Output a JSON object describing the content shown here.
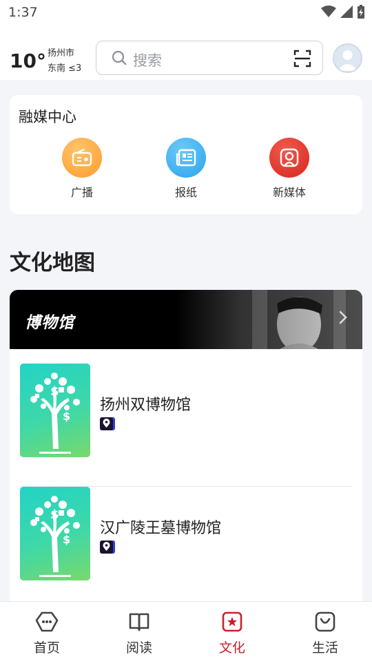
{
  "status_bar": {
    "time": "1:37"
  },
  "weather": {
    "temperature": "10°",
    "city": "扬州市",
    "wind": "东南 ≤3"
  },
  "search": {
    "placeholder": "搜索"
  },
  "media_center": {
    "title": "融媒中心",
    "items": [
      {
        "label": "广播",
        "icon": "radio-icon",
        "color": "#ffa83a"
      },
      {
        "label": "报纸",
        "icon": "newspaper-icon",
        "color": "#3aaef0"
      },
      {
        "label": "新媒体",
        "icon": "new-media-icon",
        "color": "#e0302c"
      }
    ]
  },
  "culture_map": {
    "title": "文化地图",
    "banner": {
      "title": "博物馆"
    },
    "items": [
      {
        "name": "扬州双博物馆"
      },
      {
        "name": "汉广陵王墓博物馆"
      }
    ]
  },
  "bottom_nav": {
    "items": [
      {
        "label": "首页",
        "icon": "home-icon",
        "active": false
      },
      {
        "label": "阅读",
        "icon": "book-icon",
        "active": false
      },
      {
        "label": "文化",
        "icon": "culture-icon",
        "active": true
      },
      {
        "label": "生活",
        "icon": "life-bag-icon",
        "active": false
      }
    ]
  },
  "colors": {
    "accent": "#c8202b",
    "background": "#f4f5f9"
  }
}
